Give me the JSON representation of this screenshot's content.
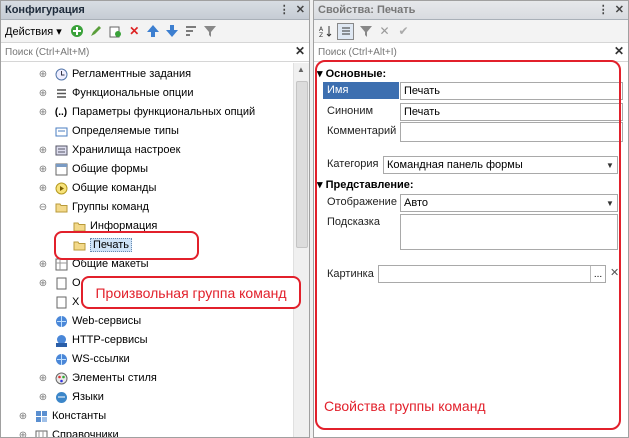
{
  "left": {
    "title": "Конфигурация",
    "ctrl_dots": "⋮",
    "ctrl_close": "✕",
    "actions_label": "Действия ▾",
    "search_placeholder": "Поиск (Ctrl+Alt+M)",
    "tree": [
      {
        "label": "Регламентные задания",
        "icon": "clock-icon",
        "exp": "⊕"
      },
      {
        "label": "Функциональные опции",
        "icon": "options-icon",
        "exp": "⊕"
      },
      {
        "label": "Параметры функциональных опций",
        "icon": "params-icon",
        "exp": "⊕"
      },
      {
        "label": "Определяемые типы",
        "icon": "types-icon",
        "exp": ""
      },
      {
        "label": "Хранилища настроек",
        "icon": "storage-icon",
        "exp": "⊕"
      },
      {
        "label": "Общие формы",
        "icon": "form-icon",
        "exp": "⊕"
      },
      {
        "label": "Общие команды",
        "icon": "command-icon",
        "exp": "⊕"
      },
      {
        "label": "Группы команд",
        "icon": "folder-icon",
        "exp": "⊖"
      },
      {
        "label": "Информация",
        "icon": "folder-icon",
        "exp": ""
      },
      {
        "label": "Печать",
        "icon": "folder-icon",
        "exp": ""
      },
      {
        "label": "Общие макеты",
        "icon": "layout-icon",
        "exp": "⊕"
      },
      {
        "label": "О",
        "icon": "doc-icon",
        "exp": "⊕"
      },
      {
        "label": "Х",
        "icon": "doc-icon",
        "exp": ""
      },
      {
        "label": "Web-сервисы",
        "icon": "globe-icon",
        "exp": ""
      },
      {
        "label": "HTTP-сервисы",
        "icon": "http-icon",
        "exp": ""
      },
      {
        "label": "WS-ссылки",
        "icon": "globe-icon",
        "exp": ""
      },
      {
        "label": "Элементы стиля",
        "icon": "style-icon",
        "exp": "⊕"
      },
      {
        "label": "Языки",
        "icon": "lang-icon",
        "exp": "⊕"
      },
      {
        "label": "Константы",
        "icon": "const-icon",
        "exp": "⊕"
      },
      {
        "label": "Справочники",
        "icon": "catalog-icon",
        "exp": "⊕"
      }
    ],
    "callout": "Произвольная группа команд"
  },
  "right": {
    "title": "Свойства: Печать",
    "ctrl_dots": "⋮",
    "ctrl_close": "✕",
    "search_placeholder": "Поиск (Ctrl+Alt+I)",
    "sections": {
      "basic": "Основные:",
      "view": "Представление:"
    },
    "props": {
      "name_label": "Имя",
      "name_value": "Печать",
      "synonym_label": "Синоним",
      "synonym_value": "Печать",
      "comment_label": "Комментарий",
      "comment_value": "",
      "category_label": "Категория",
      "category_value": "Командная панель формы",
      "display_label": "Отображение",
      "display_value": "Авто",
      "hint_label": "Подсказка",
      "hint_value": "",
      "picture_label": "Картинка",
      "picture_value": "",
      "picture_btn": "...",
      "picture_clear": "✕"
    },
    "annotation": "Свойства группы команд"
  }
}
